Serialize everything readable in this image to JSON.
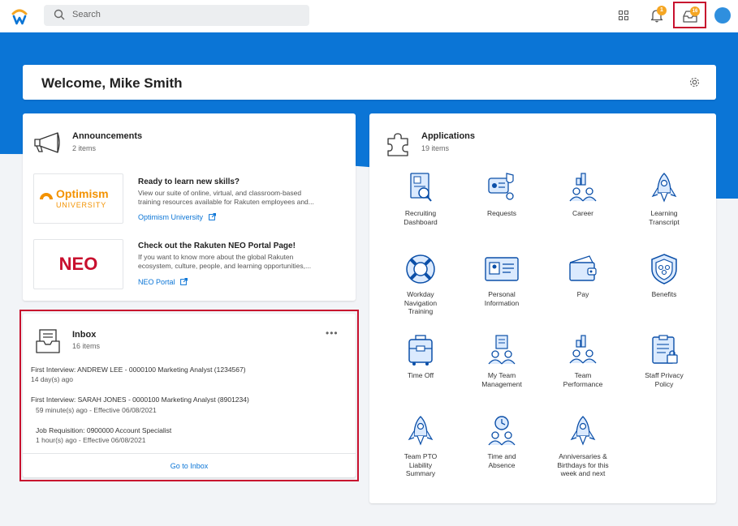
{
  "topbar": {
    "search_placeholder": "Search",
    "notifications_count": "1",
    "inbox_count": "16",
    "icons": [
      "workday-logo",
      "search-icon",
      "apps-grid-icon",
      "bell-icon",
      "inbox-icon",
      "avatar"
    ]
  },
  "welcome": {
    "title": "Welcome, Mike Smith"
  },
  "announcements": {
    "title": "Announcements",
    "count": "2 items",
    "items": [
      {
        "logo_main": "Optimism",
        "logo_sub": "UNIVERSITY",
        "heading": "Ready to learn new skills?",
        "desc_line1": "View our suite of online, virtual, and classroom-based",
        "desc_line2": "training resources available for Rakuten employees and...",
        "link": "Optimism University"
      },
      {
        "logo_main": "NEO",
        "heading": "Check out the Rakuten NEO Portal Page!",
        "desc_line1": "If you want to know more about the global Rakuten",
        "desc_line2": "ecosystem, culture, people, and learning opportunities,...",
        "link": "NEO Portal"
      }
    ]
  },
  "inbox": {
    "title": "Inbox",
    "count": "16 items",
    "more": "•••",
    "tasks": [
      {
        "title": "First Interview: ANDREW LEE - 0000100 Marketing Analyst (1234567)",
        "meta": "14 day(s) ago"
      },
      {
        "title": "First Interview: SARAH JONES - 0000100 Marketing Analyst (8901234)",
        "meta": "59 minute(s) ago - Effective 06/08/2021"
      },
      {
        "title": "Job Requisition: 0900000 Account Specialist",
        "meta": "1 hour(s) ago - Effective 06/08/2021"
      }
    ],
    "go_link": "Go to Inbox"
  },
  "applications": {
    "title": "Applications",
    "count": "19 items",
    "apps": [
      {
        "l1": "Recruiting",
        "l2": "Dashboard",
        "l3": "",
        "icon": "recruiting-icon"
      },
      {
        "l1": "Requests",
        "l2": "",
        "l3": "",
        "icon": "requests-icon"
      },
      {
        "l1": "Career",
        "l2": "",
        "l3": "",
        "icon": "career-icon"
      },
      {
        "l1": "Learning",
        "l2": "Transcript",
        "l3": "",
        "icon": "learning-icon"
      },
      {
        "l1": "Workday",
        "l2": "Navigation",
        "l3": "Training",
        "icon": "lifebuoy-icon"
      },
      {
        "l1": "Personal",
        "l2": "Information",
        "l3": "",
        "icon": "id-card-icon"
      },
      {
        "l1": "Pay",
        "l2": "",
        "l3": "",
        "icon": "wallet-icon"
      },
      {
        "l1": "Benefits",
        "l2": "",
        "l3": "",
        "icon": "shield-icon"
      },
      {
        "l1": "Time Off",
        "l2": "",
        "l3": "",
        "icon": "suitcase-icon"
      },
      {
        "l1": "My Team",
        "l2": "Management",
        "l3": "",
        "icon": "team-icon"
      },
      {
        "l1": "Team",
        "l2": "Performance",
        "l3": "",
        "icon": "performance-icon"
      },
      {
        "l1": "Staff Privacy",
        "l2": "Policy",
        "l3": "",
        "icon": "clipboard-lock-icon"
      },
      {
        "l1": "Team PTO",
        "l2": "Liability",
        "l3": "Summary",
        "icon": "rocket-icon"
      },
      {
        "l1": "Time and",
        "l2": "Absence",
        "l3": "",
        "icon": "time-absence-icon"
      },
      {
        "l1": "Anniversaries &",
        "l2": "Birthdays for this",
        "l3": "week and next",
        "icon": "rocket-icon"
      }
    ]
  }
}
